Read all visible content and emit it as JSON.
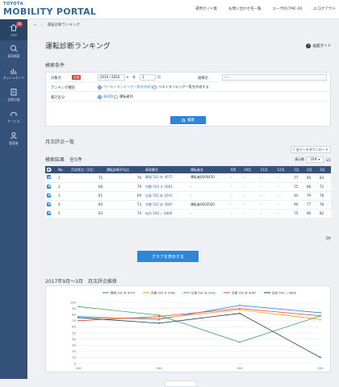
{
  "brand": {
    "small": "TOYOTA",
    "big": "MOBILITY PORTAL"
  },
  "toplinks": [
    "運用ガイド集",
    "お問い合わせ先一覧",
    "ユーザID:TMC-00",
    "ログアウト"
  ],
  "sidebar": {
    "badge": "36",
    "items": [
      {
        "label": "TOP",
        "icon": "home-icon"
      },
      {
        "label": "車両検索",
        "icon": "car-search-icon"
      },
      {
        "label": "ダッシュボード",
        "icon": "dashboard-icon"
      },
      {
        "label": "定期点検",
        "icon": "inspection-icon"
      },
      {
        "label": "サービス",
        "icon": "service-icon"
      },
      {
        "label": "管理者",
        "icon": "admin-icon"
      }
    ]
  },
  "breadcrumb": {
    "home": "«",
    "current": "運転診断ランキング"
  },
  "page": {
    "title": "運転診断ランキング",
    "guide": "画面ガイド"
  },
  "conditions": {
    "section": "検索条件",
    "period_label": "対象月",
    "required": "必須",
    "year": "2019 / 2020",
    "month": "3",
    "month_unit": "月",
    "org_label": "組織名",
    "org_value": "----",
    "rank_label": "ランキング種別",
    "rank_opt1": "ワーストランキング一覧を作成する",
    "rank_opt2": "ベストランキング一覧を作成する",
    "agg_label": "集計区分",
    "agg_opt1": "車両別",
    "agg_opt2": "運転者別",
    "search": "検索"
  },
  "monthly": {
    "section": "月次評点一覧"
  },
  "download": "全データダウンロード",
  "results": {
    "title": "検索結果　全5件",
    "perpage_label": "表示数",
    "perpage_value": "20件",
    "perpage_unit": "1/1",
    "headers": [
      "No.",
      "月次評点（1月）",
      "運転診断平均点",
      "車両番号",
      "運転者名",
      "9月",
      "10月",
      "11月",
      "12月",
      "1月",
      "2月"
    ],
    "rows": [
      [
        "1",
        "72",
        "79",
        "静岡 502 を 4075",
        "運転者0000450",
        "-",
        "-",
        "-",
        "-",
        "77",
        "95",
        "83"
      ],
      [
        "2",
        "68",
        "79",
        "京都 503 す 2081",
        "-",
        "-",
        "-",
        "-",
        "-",
        "75",
        "88",
        "72"
      ],
      [
        "3",
        "61",
        "69",
        "広島 502 あ 2041",
        "-",
        "-",
        "-",
        "-",
        "-",
        "93",
        "79",
        "78"
      ],
      [
        "4",
        "60",
        "73",
        "京都 502 あ 4087",
        "運転者0002500",
        "-",
        "-",
        "-",
        "-",
        "90",
        "77",
        "78"
      ],
      [
        "5",
        "63",
        "74",
        "仙台 500 ○ 4808",
        "-",
        "-",
        "-",
        "-",
        "-",
        "75",
        "66",
        "82"
      ]
    ],
    "count": "5件"
  },
  "graph_button": "グラフを表示する",
  "chart_data": {
    "type": "line",
    "title": "2017年9月〜3月　月次評点推移",
    "ylim": [
      0,
      100
    ],
    "yticks": [
      0,
      10,
      20,
      30,
      40,
      50,
      60,
      70,
      80,
      90,
      100
    ],
    "x": [
      "100",
      "150",
      "200",
      "250"
    ],
    "series": [
      {
        "name": "静岡 502 を 4075",
        "color": "#2f86d6",
        "values": [
          77,
          72,
          95,
          83
        ]
      },
      {
        "name": "京都 503 す 2081",
        "color": "#f39a28",
        "values": [
          75,
          74,
          88,
          72
        ]
      },
      {
        "name": "広島 502 あ 2041",
        "color": "#3aa55d",
        "values": [
          93,
          79,
          35,
          78
        ]
      },
      {
        "name": "京都 502 あ 4087",
        "color": "#e0463c",
        "values": [
          70,
          77,
          90,
          78
        ]
      },
      {
        "name": "仙台 500 ○ 4808",
        "color": "#1c3d6e",
        "values": [
          75,
          66,
          82,
          10
        ]
      }
    ]
  }
}
